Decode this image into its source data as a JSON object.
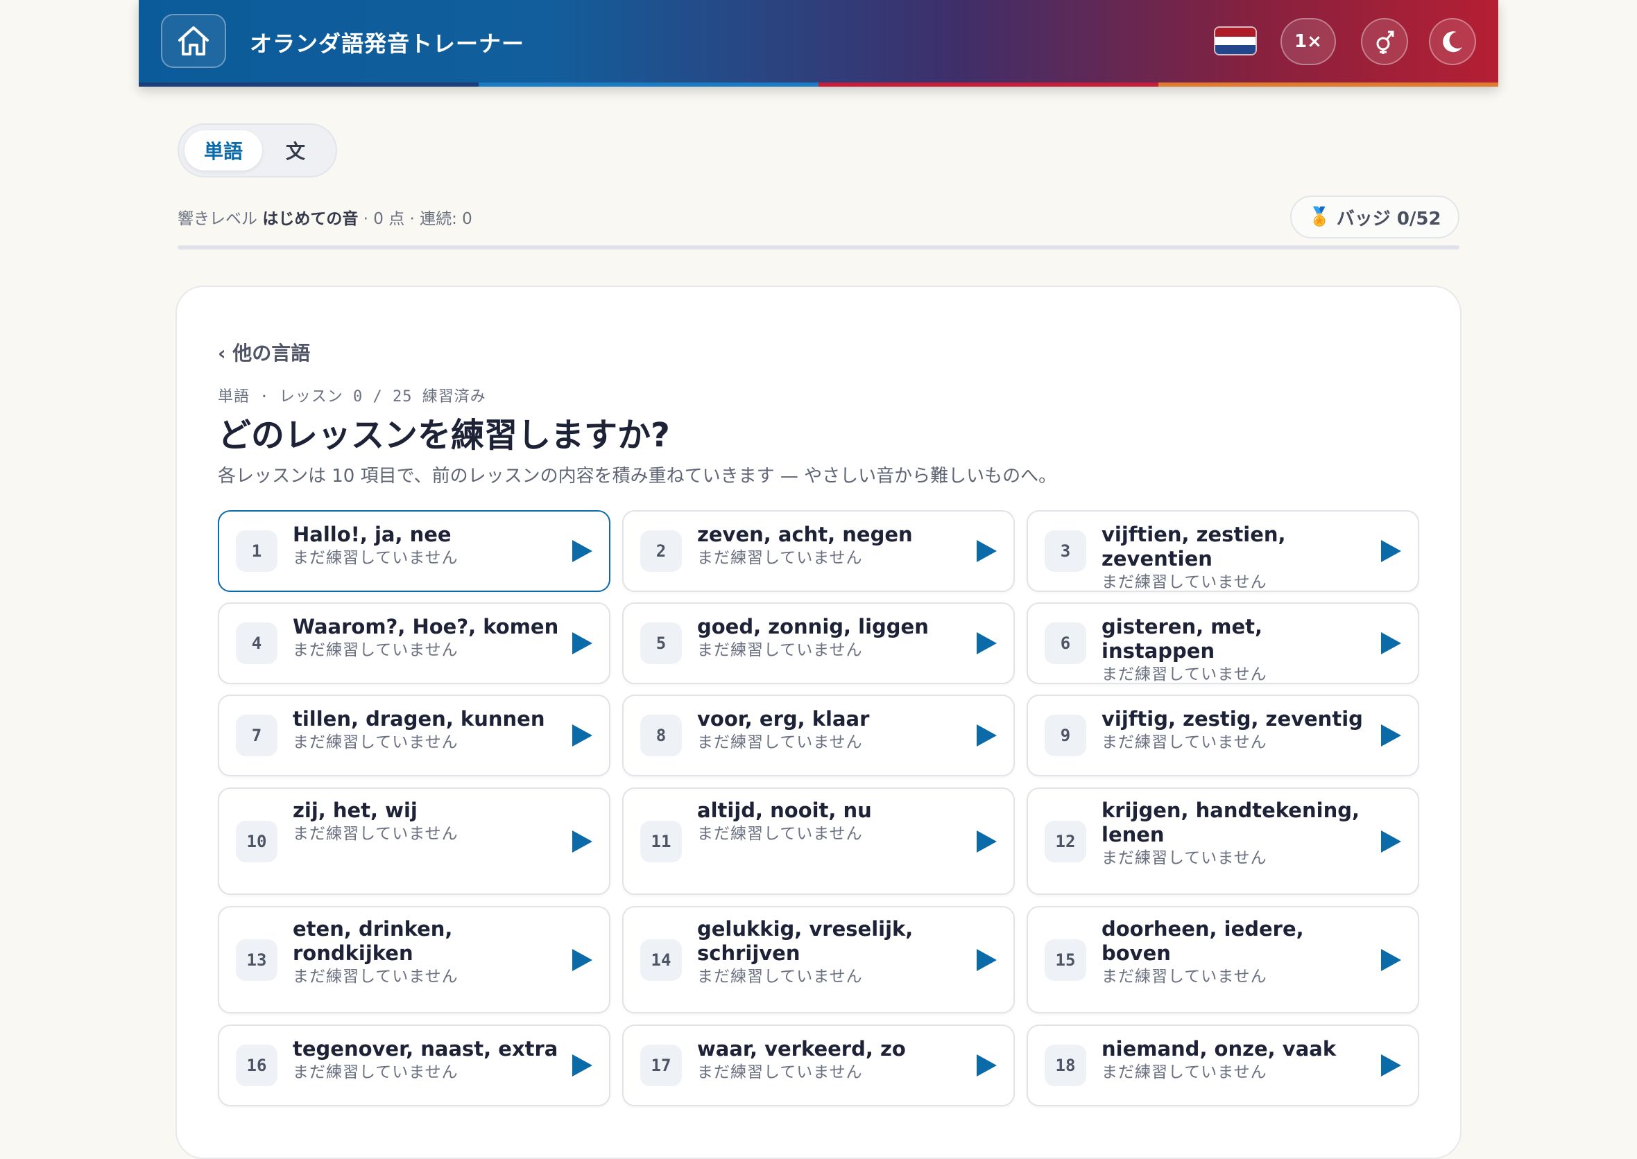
{
  "header": {
    "title": "オランダ語発音トレーナー",
    "speed_label": "1×",
    "flag_colors": [
      "#ae1c28",
      "#ffffff",
      "#21468b"
    ],
    "stripe_colors": [
      "#1b3f7a",
      "#1a7ac2",
      "#c41e3a",
      "#e07a2e"
    ],
    "icons": [
      "home-icon",
      "flag-icon",
      "gender-icon",
      "moon-icon"
    ]
  },
  "mode_tabs": {
    "active": "単語",
    "inactive": "文"
  },
  "status": {
    "level_prefix": "響きレベル",
    "level_name": "はじめての音",
    "stats": "· 0 点 · 連続: 0"
  },
  "badges": {
    "icon": "🏅",
    "label": "バッジ 0/52"
  },
  "progress_percent": 0,
  "main": {
    "back_link": "‹ 他の言語",
    "breadcrumb": "単語 · レッスン 0 / 25 練習済み",
    "title": "どのレッスンを練習しますか?",
    "description": "各レッスンは 10 項目で、前のレッスンの内容を積み重ねていきます — やさしい音から難しいものへ。"
  },
  "accent_color": "#0b6aa8",
  "lessons": [
    {
      "number": "1",
      "words": "Hallo!, ja, nee",
      "status": "まだ練習していません",
      "selected": true
    },
    {
      "number": "2",
      "words": "zeven, acht, negen",
      "status": "まだ練習していません"
    },
    {
      "number": "3",
      "words": "vijftien, zestien, zeventien",
      "status": "まだ練習していません"
    },
    {
      "number": "4",
      "words": "Waarom?, Hoe?, komen",
      "status": "まだ練習していません"
    },
    {
      "number": "5",
      "words": "goed, zonnig, liggen",
      "status": "まだ練習していません"
    },
    {
      "number": "6",
      "words": "gisteren, met, instappen",
      "status": "まだ練習していません"
    },
    {
      "number": "7",
      "words": "tillen, dragen, kunnen",
      "status": "まだ練習していません"
    },
    {
      "number": "8",
      "words": "voor, erg, klaar",
      "status": "まだ練習していません"
    },
    {
      "number": "9",
      "words": "vijftig, zestig, zeventig",
      "status": "まだ練習していません"
    },
    {
      "number": "10",
      "words": "zij, het, wij",
      "status": "まだ練習していません"
    },
    {
      "number": "11",
      "words": "altijd, nooit, nu",
      "status": "まだ練習していません"
    },
    {
      "number": "12",
      "words": "krijgen, handtekening, lenen",
      "status": "まだ練習していません"
    },
    {
      "number": "13",
      "words": "eten, drinken, rondkijken",
      "status": "まだ練習していません"
    },
    {
      "number": "14",
      "words": "gelukkig, vreselijk, schrijven",
      "status": "まだ練習していません"
    },
    {
      "number": "15",
      "words": "doorheen, iedere, boven",
      "status": "まだ練習していません"
    },
    {
      "number": "16",
      "words": "tegenover, naast, extra",
      "status": "まだ練習していません"
    },
    {
      "number": "17",
      "words": "waar, verkeerd, zo",
      "status": "まだ練習していません"
    },
    {
      "number": "18",
      "words": "niemand, onze, vaak",
      "status": "まだ練習していません"
    }
  ]
}
